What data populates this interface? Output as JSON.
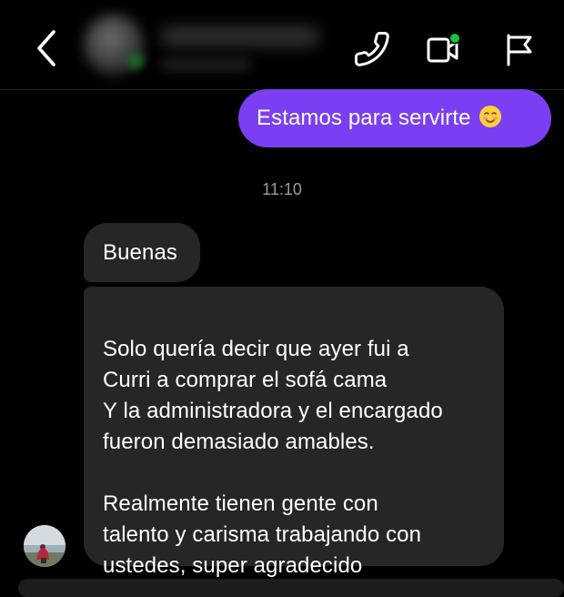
{
  "header": {
    "back_icon": "chevron-left-icon",
    "call_icon": "phone-icon",
    "video_icon": "video-camera-icon",
    "flag_icon": "flag-icon",
    "active_status_color": "#19c23a"
  },
  "messages": {
    "outgoing_1": {
      "text": "Estamos para servirte",
      "emoji": "☺️",
      "bubble_color": "#7a3ff2"
    },
    "timestamp": "11:10",
    "incoming_1": {
      "text": "Buenas"
    },
    "incoming_2": {
      "text": "Solo quería decir que ayer fui a\nCurri a comprar el sofá cama\nY la administradora y el encargado\nfueron demasiado amables.\n\nRealmente tienen gente con\ntalento y carisma trabajando con\nustedes, super agradecido"
    },
    "incoming_bubble_color": "#262626"
  }
}
